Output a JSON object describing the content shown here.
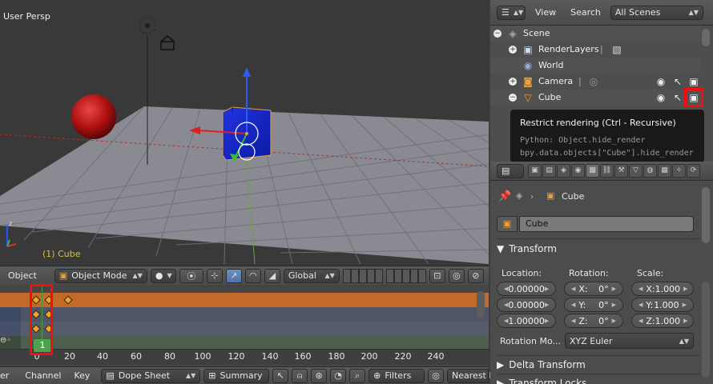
{
  "viewport": {
    "view_label": "User Persp",
    "object_label": "(1) Cube"
  },
  "view3d_header": {
    "menu_object": "Object",
    "mode": "Object Mode",
    "orientation": "Global"
  },
  "timeline": {
    "ticks": [
      "0",
      "20",
      "40",
      "60",
      "80",
      "100",
      "120",
      "140",
      "160",
      "180",
      "200",
      "220",
      "240"
    ],
    "current_frame": "1"
  },
  "dopesheet_header": {
    "menus": [
      "er",
      "Channel",
      "Key"
    ],
    "editor": "Dope Sheet",
    "summary": "Summary",
    "filters": "Filters",
    "snap": "Nearest F"
  },
  "outliner": {
    "header": {
      "view": "View",
      "search": "Search",
      "display_mode": "All Scenes"
    },
    "items": [
      {
        "name": "Scene",
        "icon": "scene-icon"
      },
      {
        "name": "RenderLayers",
        "icon": "render-layers-icon"
      },
      {
        "name": "World",
        "icon": "world-icon"
      },
      {
        "name": "Camera",
        "icon": "camera-object-icon"
      },
      {
        "name": "Cube",
        "icon": "mesh-object-icon"
      }
    ]
  },
  "tooltip": {
    "title": "Restrict rendering (Ctrl - Recursive)",
    "python1": "Python: Object.hide_render",
    "python2": "bpy.data.objects[\"Cube\"].hide_render"
  },
  "properties": {
    "breadcrumb_object": "Cube",
    "object_name": "Cube",
    "transform_title": "Transform",
    "location_label": "Location:",
    "rotation_label": "Rotation:",
    "scale_label": "Scale:",
    "location": [
      "0.00000",
      "0.00000",
      "1.00000"
    ],
    "rotation": [
      {
        "axis": "X:",
        "value": "0°"
      },
      {
        "axis": "Y:",
        "value": "0°"
      },
      {
        "axis": "Z:",
        "value": "0°"
      }
    ],
    "scale": [
      {
        "axis": "X:",
        "value": "1.000"
      },
      {
        "axis": "Y:",
        "value": "1.000"
      },
      {
        "axis": "Z:",
        "value": "1.000"
      }
    ],
    "rotation_mode_label": "Rotation Mo...",
    "rotation_mode": "XYZ Euler",
    "delta_transform": "Delta Transform",
    "transform_locks": "Transform Locks"
  },
  "colors": {
    "highlight_box": "#ff0a0a",
    "keyframe": "#f0a522",
    "active_channel": "#c36a2a",
    "cube_blue": "#1428c8",
    "sphere_red": "#c81414"
  }
}
